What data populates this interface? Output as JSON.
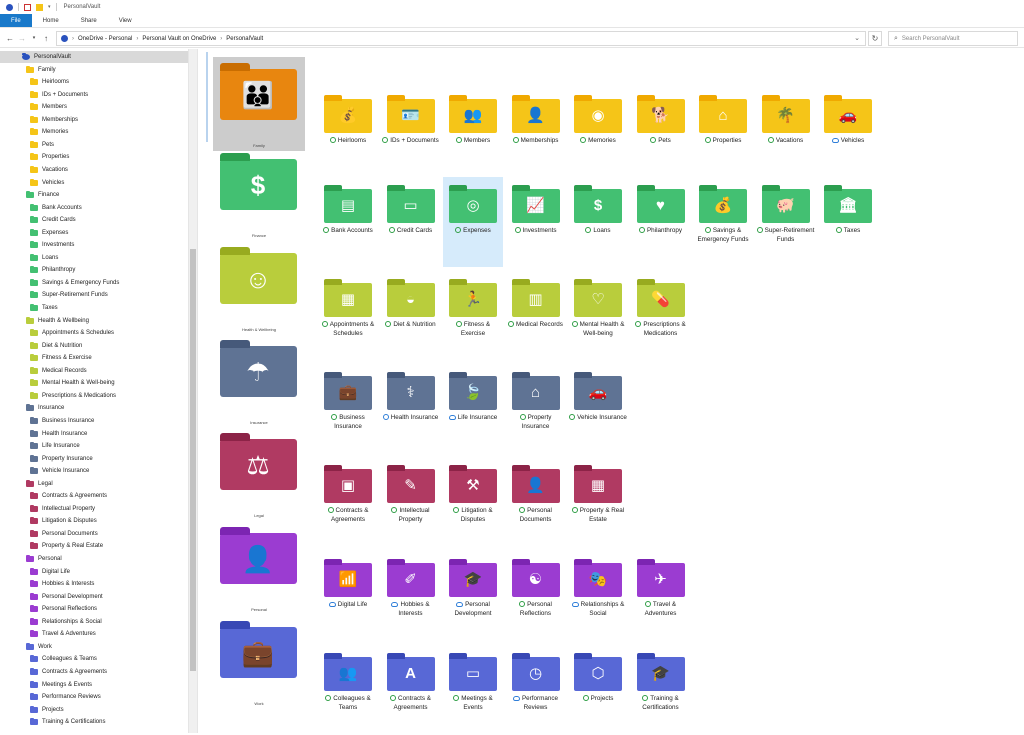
{
  "window": {
    "title": "PersonalVault"
  },
  "ribbon": {
    "tabs": [
      "File",
      "Home",
      "Share",
      "View"
    ]
  },
  "address": {
    "crumbs": [
      "OneDrive - Personal",
      "Personal Vault on OneDrive",
      "PersonalVault"
    ],
    "search_placeholder": "Search PersonalVault"
  },
  "colors": {
    "family": "#f5c518",
    "family_dark": "#f0a900",
    "finance": "#43c072",
    "finance_dark": "#2c9e4f",
    "health": "#b9cd3c",
    "health_dark": "#98ab1f",
    "insurance": "#5f7394",
    "insurance_dark": "#46597a",
    "legal": "#b03a62",
    "legal_dark": "#8c2347",
    "personal": "#9b3cd1",
    "personal_dark": "#7c25b2",
    "work": "#5868d6",
    "work_dark": "#3848b5",
    "big_family": "#e8860f"
  },
  "tree": [
    {
      "label": "PersonalVault",
      "level": 0,
      "color": "vault",
      "selected": true
    },
    {
      "label": "Family",
      "level": 1,
      "color": "family"
    },
    {
      "label": "Heirlooms",
      "level": 2,
      "color": "family"
    },
    {
      "label": "IDs + Documents",
      "level": 2,
      "color": "family"
    },
    {
      "label": "Members",
      "level": 2,
      "color": "family"
    },
    {
      "label": "Memberships",
      "level": 2,
      "color": "family"
    },
    {
      "label": "Memories",
      "level": 2,
      "color": "family"
    },
    {
      "label": "Pets",
      "level": 2,
      "color": "family"
    },
    {
      "label": "Properties",
      "level": 2,
      "color": "family"
    },
    {
      "label": "Vacations",
      "level": 2,
      "color": "family"
    },
    {
      "label": "Vehicles",
      "level": 2,
      "color": "family"
    },
    {
      "label": "Finance",
      "level": 1,
      "color": "finance"
    },
    {
      "label": "Bank Accounts",
      "level": 2,
      "color": "finance"
    },
    {
      "label": "Credit Cards",
      "level": 2,
      "color": "finance"
    },
    {
      "label": "Expenses",
      "level": 2,
      "color": "finance"
    },
    {
      "label": "Investments",
      "level": 2,
      "color": "finance"
    },
    {
      "label": "Loans",
      "level": 2,
      "color": "finance"
    },
    {
      "label": "Philanthropy",
      "level": 2,
      "color": "finance"
    },
    {
      "label": "Savings & Emergency Funds",
      "level": 2,
      "color": "finance"
    },
    {
      "label": "Super-Retirement Funds",
      "level": 2,
      "color": "finance"
    },
    {
      "label": "Taxes",
      "level": 2,
      "color": "finance"
    },
    {
      "label": "Health & Wellbeing",
      "level": 1,
      "color": "health"
    },
    {
      "label": "Appointments & Schedules",
      "level": 2,
      "color": "health"
    },
    {
      "label": "Diet & Nutrition",
      "level": 2,
      "color": "health"
    },
    {
      "label": "Fitness & Exercise",
      "level": 2,
      "color": "health"
    },
    {
      "label": "Medical Records",
      "level": 2,
      "color": "health"
    },
    {
      "label": "Mental Health & Well-being",
      "level": 2,
      "color": "health"
    },
    {
      "label": "Prescriptions & Medications",
      "level": 2,
      "color": "health"
    },
    {
      "label": "Insurance",
      "level": 1,
      "color": "insurance"
    },
    {
      "label": "Business Insurance",
      "level": 2,
      "color": "insurance"
    },
    {
      "label": "Health Insurance",
      "level": 2,
      "color": "insurance"
    },
    {
      "label": "Life Insurance",
      "level": 2,
      "color": "insurance"
    },
    {
      "label": "Property Insurance",
      "level": 2,
      "color": "insurance"
    },
    {
      "label": "Vehicle Insurance",
      "level": 2,
      "color": "insurance"
    },
    {
      "label": "Legal",
      "level": 1,
      "color": "legal"
    },
    {
      "label": "Contracts & Agreements",
      "level": 2,
      "color": "legal"
    },
    {
      "label": "Intellectual Property",
      "level": 2,
      "color": "legal"
    },
    {
      "label": "Litigation & Disputes",
      "level": 2,
      "color": "legal"
    },
    {
      "label": "Personal Documents",
      "level": 2,
      "color": "legal"
    },
    {
      "label": "Property & Real Estate",
      "level": 2,
      "color": "legal"
    },
    {
      "label": "Personal",
      "level": 1,
      "color": "personal"
    },
    {
      "label": "Digital Life",
      "level": 2,
      "color": "personal"
    },
    {
      "label": "Hobbies & Interests",
      "level": 2,
      "color": "personal"
    },
    {
      "label": "Personal Development",
      "level": 2,
      "color": "personal"
    },
    {
      "label": "Personal Reflections",
      "level": 2,
      "color": "personal"
    },
    {
      "label": "Relationships & Social",
      "level": 2,
      "color": "personal"
    },
    {
      "label": "Travel & Adventures",
      "level": 2,
      "color": "personal"
    },
    {
      "label": "Work",
      "level": 1,
      "color": "work"
    },
    {
      "label": "Colleagues & Teams",
      "level": 2,
      "color": "work"
    },
    {
      "label": "Contracts & Agreements",
      "level": 2,
      "color": "work"
    },
    {
      "label": "Meetings & Events",
      "level": 2,
      "color": "work"
    },
    {
      "label": "Performance Reviews",
      "level": 2,
      "color": "work"
    },
    {
      "label": "Projects",
      "level": 2,
      "color": "work"
    },
    {
      "label": "Training & Certifications",
      "level": 2,
      "color": "work"
    }
  ],
  "groups": [
    {
      "name": "Family",
      "color": "family",
      "big_color": "big_family",
      "glyph": "👪",
      "selected": true,
      "items": [
        {
          "label": "Heirlooms",
          "glyph": "💰",
          "status": "ok"
        },
        {
          "label": "IDs + Documents",
          "glyph": "🪪",
          "status": "ok"
        },
        {
          "label": "Members",
          "glyph": "👥",
          "status": "ok"
        },
        {
          "label": "Memberships",
          "glyph": "👤",
          "status": "ok"
        },
        {
          "label": "Memories",
          "glyph": "◉",
          "status": "ok"
        },
        {
          "label": "Pets",
          "glyph": "🐕",
          "status": "ok"
        },
        {
          "label": "Properties",
          "glyph": "⌂",
          "status": "ok"
        },
        {
          "label": "Vacations",
          "glyph": "🌴",
          "status": "ok"
        },
        {
          "label": "Vehicles",
          "glyph": "🚗",
          "status": "cloud"
        }
      ]
    },
    {
      "name": "Finance",
      "color": "finance",
      "glyph": "$",
      "items": [
        {
          "label": "Bank Accounts",
          "glyph": "▤",
          "status": "ok"
        },
        {
          "label": "Credit Cards",
          "glyph": "▭",
          "status": "ok"
        },
        {
          "label": "Expenses",
          "glyph": "◎",
          "status": "ok",
          "selected": true
        },
        {
          "label": "Investments",
          "glyph": "📈",
          "status": "ok"
        },
        {
          "label": "Loans",
          "glyph": "$",
          "status": "ok"
        },
        {
          "label": "Philanthropy",
          "glyph": "♥",
          "status": "ok"
        },
        {
          "label": "Savings & Emergency Funds",
          "glyph": "💰",
          "status": "ok"
        },
        {
          "label": "Super-Retirement Funds",
          "glyph": "🐖",
          "status": "ok"
        },
        {
          "label": "Taxes",
          "glyph": "🏛",
          "status": "ok"
        }
      ]
    },
    {
      "name": "Health & Wellbeing",
      "color": "health",
      "glyph": "☺",
      "items": [
        {
          "label": "Appointments & Schedules",
          "glyph": "▦",
          "status": "ok"
        },
        {
          "label": "Diet & Nutrition",
          "glyph": "◒",
          "status": "ok"
        },
        {
          "label": "Fitness & Exercise",
          "glyph": "🏃",
          "status": "ok"
        },
        {
          "label": "Medical Records",
          "glyph": "▥",
          "status": "ok"
        },
        {
          "label": "Mental Health & Well-being",
          "glyph": "♡",
          "status": "ok"
        },
        {
          "label": "Prescriptions & Medications",
          "glyph": "💊",
          "status": "ok"
        }
      ]
    },
    {
      "name": "Insurance",
      "color": "insurance",
      "glyph": "☂",
      "status": "sync",
      "items": [
        {
          "label": "Business Insurance",
          "glyph": "💼",
          "status": "ok"
        },
        {
          "label": "Health Insurance",
          "glyph": "⚕",
          "status": "sync"
        },
        {
          "label": "Life Insurance",
          "glyph": "🍃",
          "status": "cloud"
        },
        {
          "label": "Property Insurance",
          "glyph": "⌂",
          "status": "ok"
        },
        {
          "label": "Vehicle Insurance",
          "glyph": "🚗",
          "status": "ok"
        }
      ]
    },
    {
      "name": "Legal",
      "color": "legal",
      "glyph": "⚖",
      "items": [
        {
          "label": "Contracts & Agreements",
          "glyph": "▣",
          "status": "ok"
        },
        {
          "label": "Intellectual Property",
          "glyph": "✎",
          "status": "ok"
        },
        {
          "label": "Litigation & Disputes",
          "glyph": "⚒",
          "status": "ok"
        },
        {
          "label": "Personal Documents",
          "glyph": "👤",
          "status": "ok"
        },
        {
          "label": "Property & Real Estate",
          "glyph": "▦",
          "status": "ok"
        }
      ]
    },
    {
      "name": "Personal",
      "color": "personal",
      "glyph": "👤",
      "items": [
        {
          "label": "Digital Life",
          "glyph": "📶",
          "status": "cloud"
        },
        {
          "label": "Hobbies & Interests",
          "glyph": "✐",
          "status": "cloud"
        },
        {
          "label": "Personal Development",
          "glyph": "🎓",
          "status": "cloud"
        },
        {
          "label": "Personal Reflections",
          "glyph": "☯",
          "status": "ok"
        },
        {
          "label": "Relationships & Social",
          "glyph": "🎭",
          "status": "cloud"
        },
        {
          "label": "Travel & Adventures",
          "glyph": "✈",
          "status": "ok"
        }
      ]
    },
    {
      "name": "Work",
      "color": "work",
      "glyph": "💼",
      "status": "cloud",
      "items": [
        {
          "label": "Colleagues & Teams",
          "glyph": "👥",
          "status": "ok"
        },
        {
          "label": "Contracts & Agreements",
          "glyph": "A",
          "status": "ok"
        },
        {
          "label": "Meetings & Events",
          "glyph": "▭",
          "status": "ok"
        },
        {
          "label": "Performance Reviews",
          "glyph": "◷",
          "status": "cloud"
        },
        {
          "label": "Projects",
          "glyph": "⬡",
          "status": "ok"
        },
        {
          "label": "Training & Certifications",
          "glyph": "🎓",
          "status": "ok"
        }
      ]
    }
  ]
}
